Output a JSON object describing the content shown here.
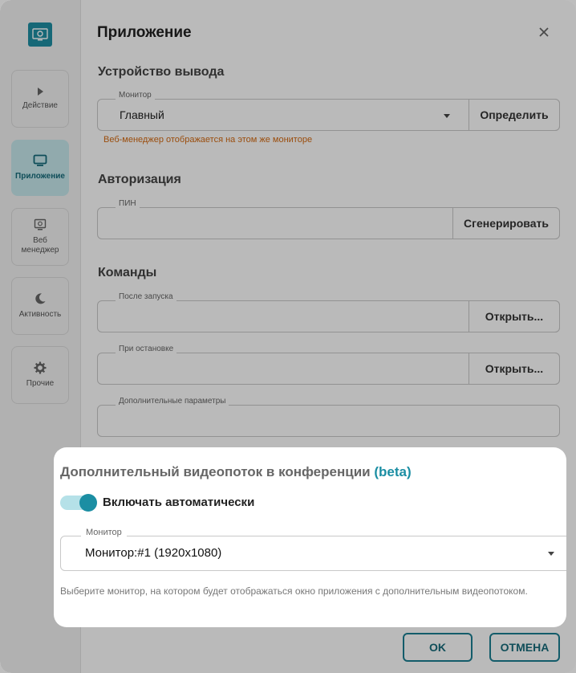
{
  "sidebar": {
    "items": [
      {
        "label": "Действие",
        "icon": "play-icon"
      },
      {
        "label": "Приложение",
        "icon": "monitor-icon"
      },
      {
        "label": "Веб менеджер",
        "icon": "web-manager-icon"
      },
      {
        "label": "Активность",
        "icon": "moon-icon"
      },
      {
        "label": "Прочие",
        "icon": "gear-icon"
      }
    ],
    "active": "Приложение"
  },
  "dialog": {
    "title": "Приложение",
    "output": {
      "heading": "Устройство вывода",
      "monitor_label": "Монитор",
      "monitor_value": "Главный",
      "detect_button": "Определить",
      "warning": "Веб-менеджер отображается на этом же мониторе"
    },
    "auth": {
      "heading": "Авторизация",
      "pin_label": "ПИН",
      "pin_value": "",
      "generate_button": "Сгенерировать"
    },
    "commands": {
      "heading": "Команды",
      "after_start_label": "После запуска",
      "after_start_button": "Открыть...",
      "on_stop_label": "При остановке",
      "on_stop_button": "Открыть...",
      "extra_params_label": "Дополнительные параметры"
    },
    "footer": {
      "ok_label": "OK",
      "cancel_label": "ОТМЕНА"
    }
  },
  "popup": {
    "title": "Дополнительный видеопоток в конференции",
    "beta": "(beta)",
    "toggle_label": "Включать автоматически",
    "toggle_on": true,
    "monitor_label": "Монитор",
    "monitor_value": "Монитор:#1 (1920x1080)",
    "hint": "Выберите монитор, на котором будет отображаться окно приложения с дополнительным видеопотоком."
  },
  "colors": {
    "accent": "#1b8ea3",
    "warning": "#d46a12",
    "active_bg": "#c7e9ee"
  }
}
